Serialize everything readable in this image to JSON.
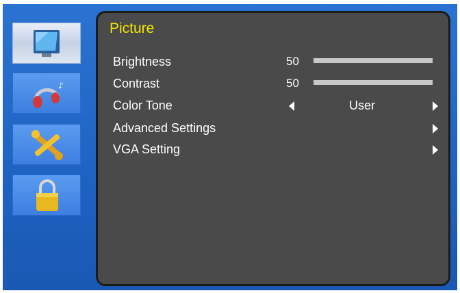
{
  "sidebar": {
    "items": [
      {
        "icon": "monitor-icon",
        "active": true
      },
      {
        "icon": "headphones-icon",
        "active": false
      },
      {
        "icon": "tools-icon",
        "active": false
      },
      {
        "icon": "lock-icon",
        "active": false
      }
    ]
  },
  "panel": {
    "title": "Picture",
    "brightness": {
      "label": "Brightness",
      "value": "50",
      "level": 0.5
    },
    "contrast": {
      "label": "Contrast",
      "value": "50",
      "level": 0.5
    },
    "color_tone": {
      "label": "Color Tone",
      "value": "User"
    },
    "advanced": {
      "label": "Advanced Settings"
    },
    "vga": {
      "label": "VGA Setting"
    }
  },
  "colors": {
    "frame_blue": "#2a73d2",
    "panel_bg": "#4a4a4a",
    "title_yellow": "#f2e600",
    "slider_gray": "#c8c8c8"
  }
}
